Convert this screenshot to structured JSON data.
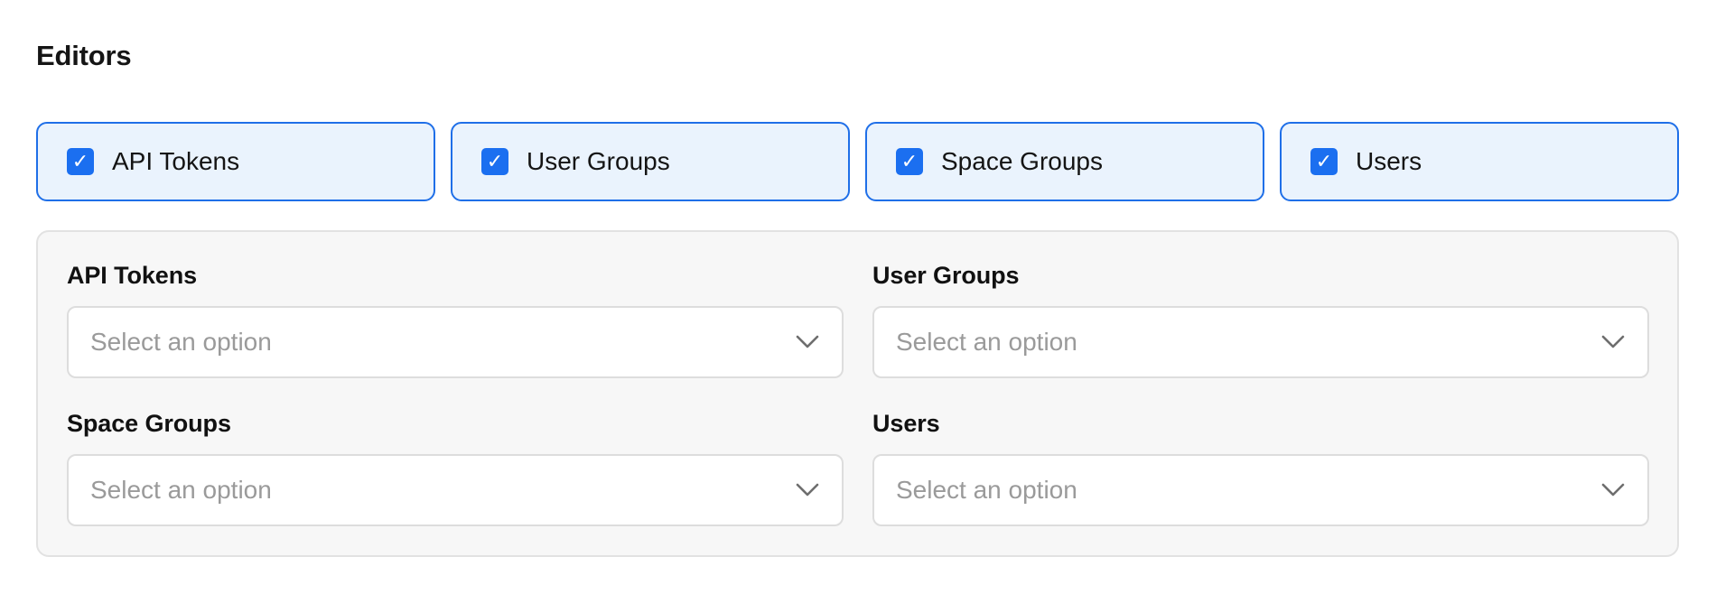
{
  "section": {
    "title": "Editors"
  },
  "chips": [
    {
      "label": "API Tokens",
      "checked": true,
      "check_glyph": "✓"
    },
    {
      "label": "User Groups",
      "checked": true,
      "check_glyph": "✓"
    },
    {
      "label": "Space Groups",
      "checked": true,
      "check_glyph": "✓"
    },
    {
      "label": "Users",
      "checked": true,
      "check_glyph": "✓"
    }
  ],
  "fields": [
    {
      "label": "API Tokens",
      "placeholder": "Select an option"
    },
    {
      "label": "User Groups",
      "placeholder": "Select an option"
    },
    {
      "label": "Space Groups",
      "placeholder": "Select an option"
    },
    {
      "label": "Users",
      "placeholder": "Select an option"
    }
  ],
  "colors": {
    "accent": "#1b6ff0",
    "chip_background": "#eaf3fd",
    "panel_background": "#f7f7f7",
    "placeholder_text": "#9a9a9a"
  },
  "icons": {
    "checkbox": "checkmark-icon",
    "select": "chevron-down-icon"
  }
}
